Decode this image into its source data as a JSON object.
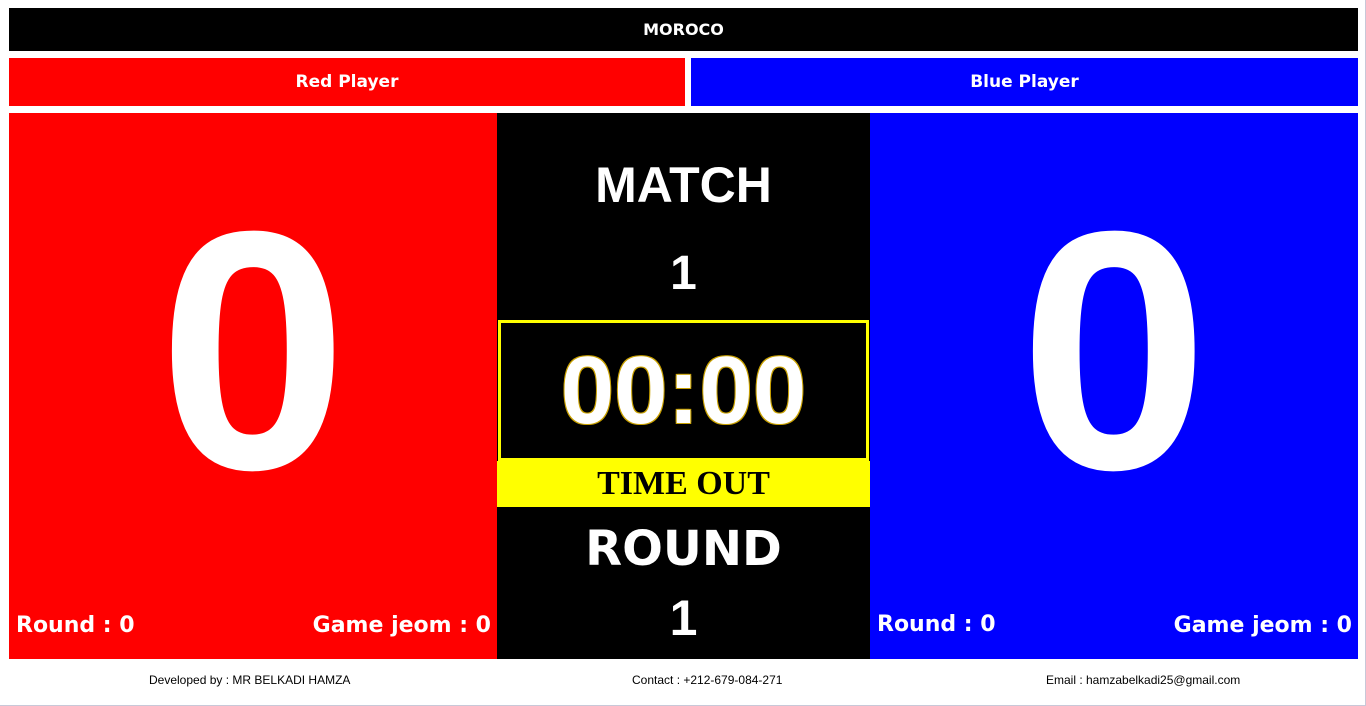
{
  "header": {
    "country": "MOROCO"
  },
  "players": {
    "red": {
      "name": "Red Player",
      "score": "0",
      "round_text": "Round : 0",
      "game_jeom_text": "Game jeom : 0",
      "color": "#ff0000"
    },
    "blue": {
      "name": "Blue Player",
      "score": "0",
      "round_text": "Round : 0",
      "game_jeom_text": "Game jeom : 0",
      "color": "#0000ff"
    }
  },
  "center": {
    "match_label": "MATCH",
    "match_number": "1",
    "timer": "00:00",
    "status": "TIME OUT",
    "round_label": "ROUND",
    "round_number": "1",
    "status_color": "#ffff00"
  },
  "footer": {
    "developer": "Developed by : MR BELKADI HAMZA",
    "contact": "Contact : +212-679-084-271",
    "email": "Email : hamzabelkadi25@gmail.com"
  }
}
